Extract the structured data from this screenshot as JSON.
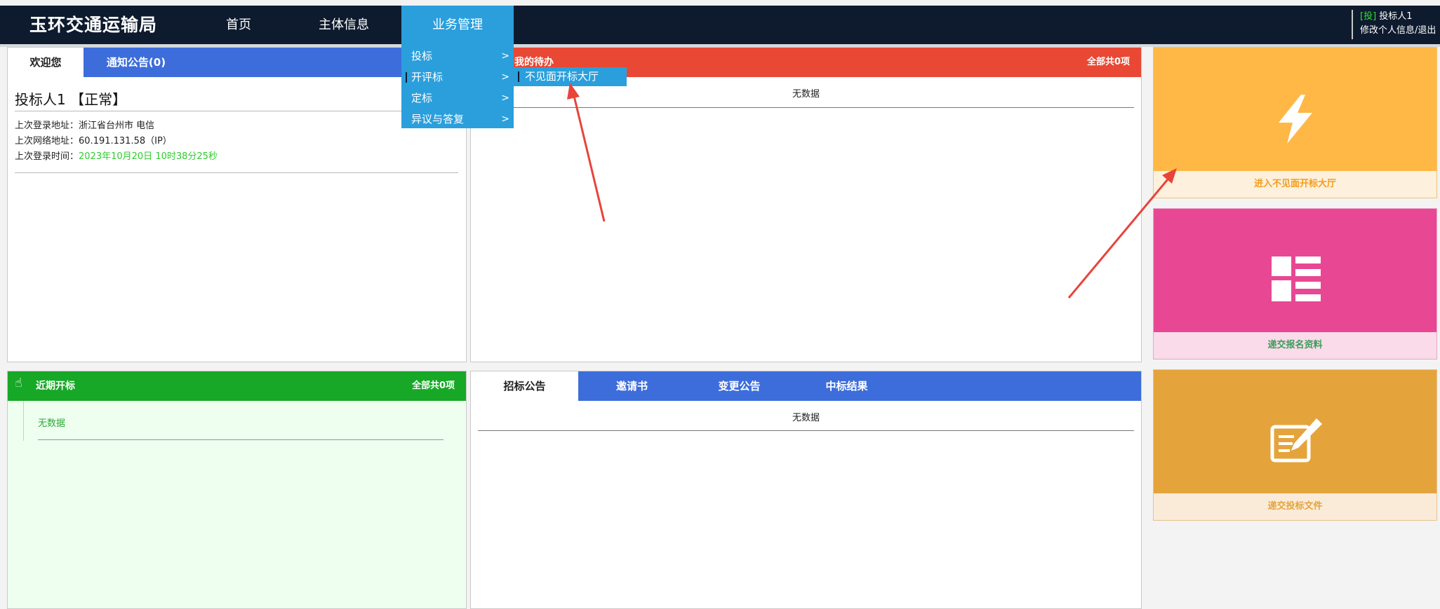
{
  "header": {
    "logo": "玉环交通运输局",
    "nav": [
      "首页",
      "主体信息",
      "业务管理"
    ],
    "user": {
      "role_tag": "[投]",
      "name": "投标人1",
      "links": "修改个人信息/退出"
    }
  },
  "dropdown": {
    "items": [
      "投标",
      "开评标",
      "定标",
      "异议与答复"
    ],
    "submenu_item": "不见面开标大厅"
  },
  "welcome_panel": {
    "tabs": [
      "欢迎您",
      "通知公告(0)"
    ],
    "user_status": "投标人1 【正常】",
    "login_addr_label": "上次登录地址：",
    "login_addr": "浙江省台州市 电信",
    "ip_label": "上次网络地址：",
    "ip": "60.191.131.58（IP）",
    "time_label": "上次登录时间：",
    "time": "2023年10月20日 10时38分25秒"
  },
  "todo_panel": {
    "title": "我的待办",
    "total": "全部共0项",
    "nodata": "无数据"
  },
  "recent_panel": {
    "title": "近期开标",
    "total": "全部共0项",
    "nodata": "无数据"
  },
  "notice_panel": {
    "tabs": [
      "招标公告",
      "邀请书",
      "变更公告",
      "中标结果"
    ],
    "nodata": "无数据"
  },
  "cards": [
    {
      "label": "进入不见面开标大厅",
      "icon": "lightning-icon",
      "color": "#ffb845",
      "label_color": "#f59c1a",
      "label_bg": "#fdf0dc"
    },
    {
      "label": "递交报名资料",
      "icon": "list-grid-icon",
      "color": "#e84893",
      "label_color": "#3a9c5c",
      "label_bg": "#f9dbe9"
    },
    {
      "label": "递交投标文件",
      "icon": "edit-document-icon",
      "color": "#e5a43b",
      "label_color": "#e5a43b",
      "label_bg": "#faebd9"
    }
  ],
  "colors": {
    "topbar": "#0e1b2e",
    "nav_active": "#2a9fdc",
    "blue_tab": "#3d6ddb",
    "red_header": "#e84834",
    "green_header": "#16a826",
    "green_panel_bg": "#eefff0",
    "annotation_arrow": "#e8443a"
  }
}
